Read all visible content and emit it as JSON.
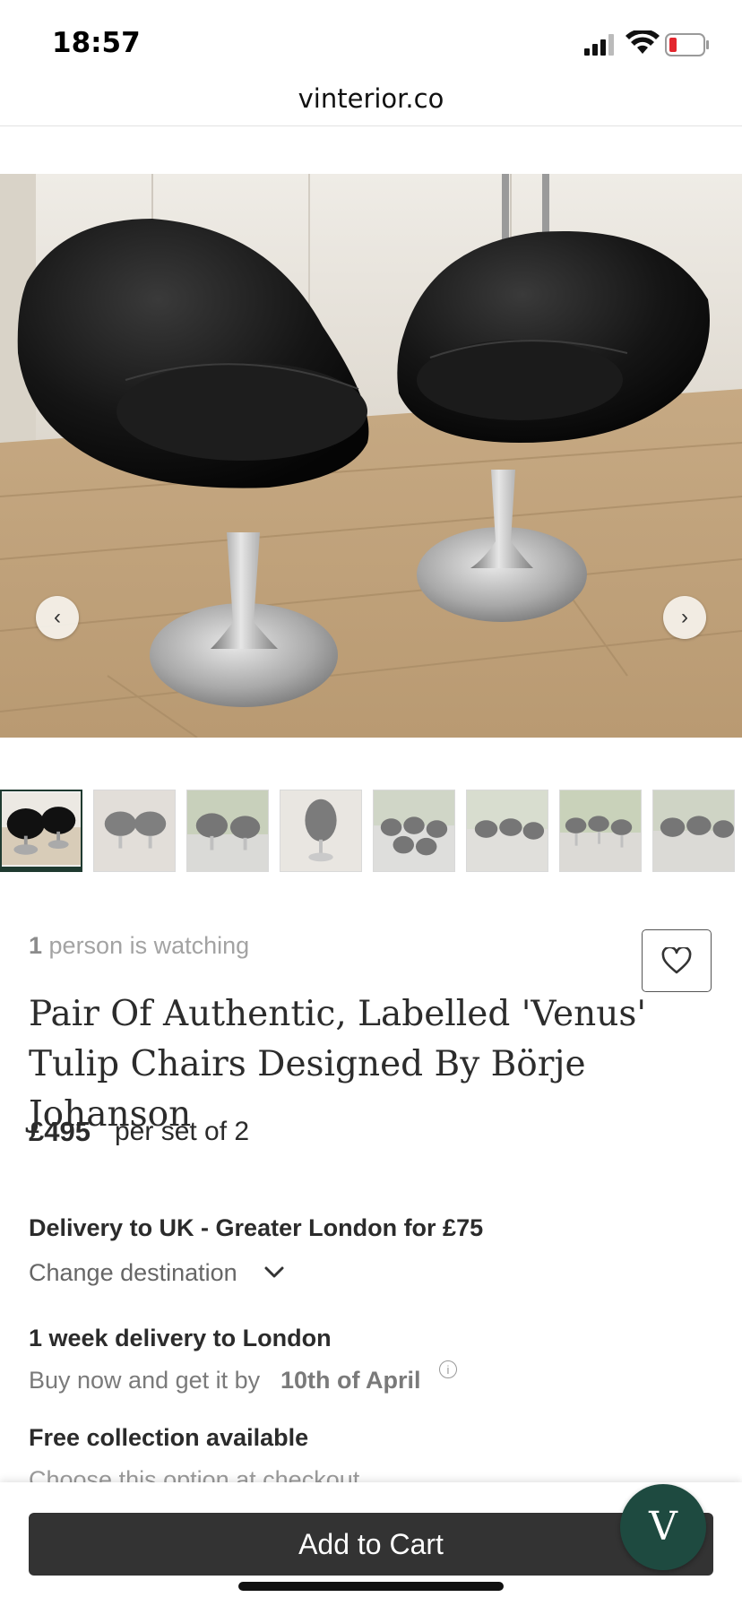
{
  "status_bar": {
    "time": "18:57"
  },
  "browser": {
    "url": "vinterior.co"
  },
  "gallery": {
    "prev_label": "‹",
    "next_label": "›",
    "thumbnail_count": 8
  },
  "product": {
    "watching_count": "1",
    "watching_text": " person is watching",
    "title": "Pair Of Authentic, Labelled 'Venus' Tulip Chairs Designed By Börje Johanson",
    "price": "£495",
    "price_unit": "per set of 2"
  },
  "delivery": {
    "headline": "Delivery to UK - Greater London for £75",
    "change_label": "Change destination",
    "speed_headline": "1 week delivery to London",
    "eta_prefix": "Buy now and get it by",
    "eta_date": "10th of April",
    "info_icon": "i",
    "collection_headline": "Free collection available",
    "collection_note": "Choose this option at checkout"
  },
  "actions": {
    "add_to_cart": "Add to Cart",
    "chat_label": "V"
  },
  "colors": {
    "brand_green": "#1e4a40",
    "cart_button": "#333333"
  }
}
